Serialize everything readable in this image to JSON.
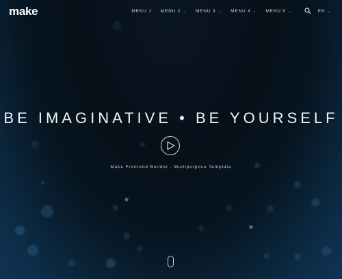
{
  "logo": "make",
  "nav": {
    "items": [
      {
        "label": "MENU 1"
      },
      {
        "label": "MENU 2"
      },
      {
        "label": "MENU 3"
      },
      {
        "label": "MENU 4"
      },
      {
        "label": "MENU 5"
      }
    ],
    "language": "EN"
  },
  "hero": {
    "title": "BE IMAGINATIVE • BE YOURSELF",
    "subtitle": "Make Frontend Builder - Multipurpose Template"
  },
  "icons": {
    "search": "search-icon",
    "play": "play-icon",
    "scroll": "scroll-mouse-icon",
    "chevron": "chevron-down-icon"
  },
  "colors": {
    "background_top": "#071019",
    "background_bottom": "#103456"
  }
}
